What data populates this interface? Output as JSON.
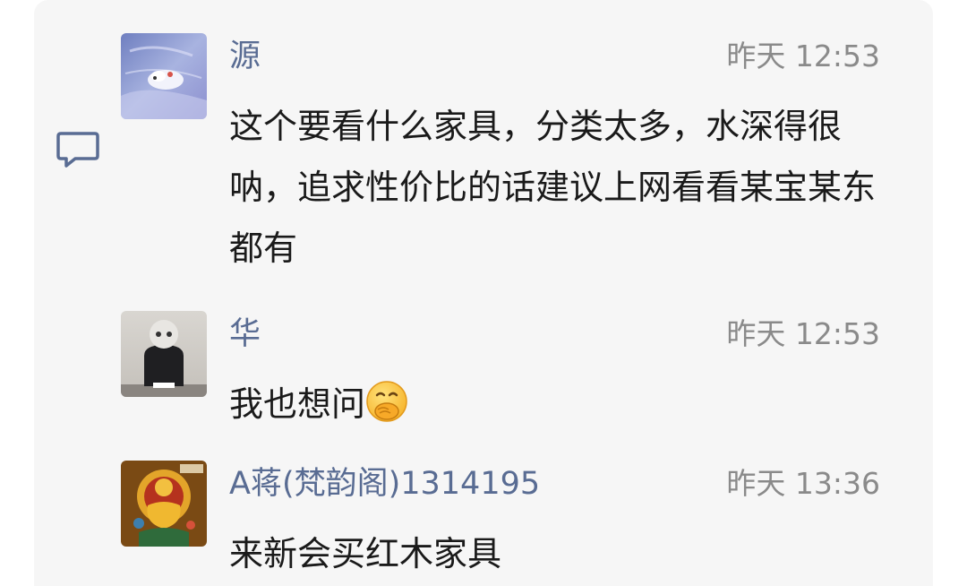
{
  "comments": [
    {
      "author": "源",
      "time": "昨天 12:53",
      "text": "这个要看什么家具，分类太多，水深得很呐，追求性价比的话建议上网看看某宝某东都有"
    },
    {
      "author": "华",
      "time": "昨天 12:53",
      "text": "我也想问",
      "emoji": "thinking-emoji"
    },
    {
      "author": "A蒋(梵韵阁)1314195",
      "time": "昨天 13:36",
      "text": "来新会买红木家具"
    }
  ],
  "colors": {
    "panel_bg": "#f6f6f6",
    "author_name": "#596c93",
    "timestamp": "#8a8a8a",
    "text": "#1a1a1a",
    "icon": "#596c93"
  },
  "icons": [
    "comment-icon",
    "thinking-emoji"
  ]
}
